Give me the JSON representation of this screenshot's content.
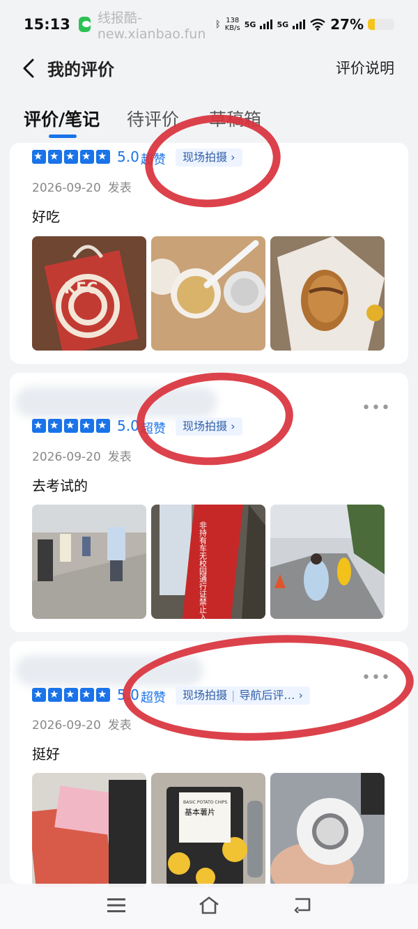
{
  "status_bar": {
    "time": "15:13",
    "source": "线报酷-new.xianbao.fun",
    "speed_value": "138",
    "speed_unit": "KB/s",
    "signal_1": "5G",
    "signal_2": "5G",
    "battery": "27%",
    "battery_level": 0.27
  },
  "header": {
    "title": "我的评价",
    "explain_link": "评价说明"
  },
  "tabs": [
    {
      "label": "评价/笔记",
      "active": true
    },
    {
      "label": "待评价",
      "active": false
    },
    {
      "label": "草稿箱",
      "active": false
    }
  ],
  "reviews": [
    {
      "score": "5.0",
      "rating_text": "超赞",
      "stars": 5,
      "tags": [
        "现场拍摄"
      ],
      "date": "2026-09-20",
      "published": "发表",
      "content": "好吃",
      "photo_count": 3
    },
    {
      "score": "5.0",
      "rating_text": "超赞",
      "stars": 5,
      "tags": [
        "现场拍摄"
      ],
      "date": "2026-09-20",
      "published": "发表",
      "content": "去考试的",
      "photo_count": 3,
      "photo_sign_text": "非持有车无校园通行证禁止入校"
    },
    {
      "score": "5.0",
      "rating_text": "超赞",
      "stars": 5,
      "tags": [
        "现场拍摄",
        "导航后评…"
      ],
      "date": "2026-09-20",
      "published": "发表",
      "content": "挺好",
      "photo_count": 3,
      "photo_pack_text": "基本薯片",
      "photo_pack_brand": "BASIC POTATO CHIPS"
    }
  ],
  "colors": {
    "accent": "#1a73e8",
    "marker": "#d9323c",
    "background": "#f2f3f5"
  },
  "icons": {
    "back": "chevron-left-icon",
    "more": "more-dots-icon",
    "nav_menu": "menu-icon",
    "nav_home": "home-icon",
    "nav_back": "return-icon"
  }
}
